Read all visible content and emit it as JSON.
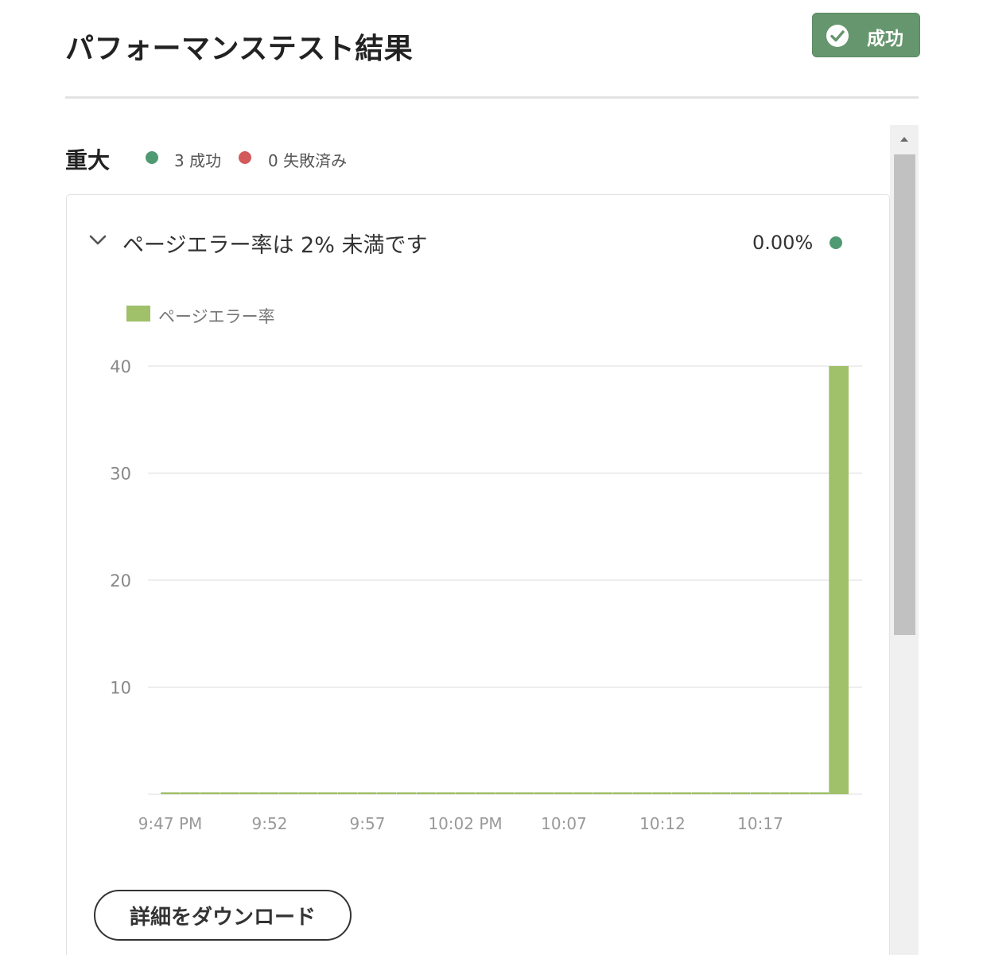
{
  "header": {
    "title": "パフォーマンステスト結果",
    "status_badge": {
      "label": "成功",
      "icon": "check-circle-icon",
      "color": "#66966d"
    }
  },
  "section": {
    "title": "重大",
    "success_count": "3",
    "success_label": "成功",
    "failed_count": "0",
    "failed_label": "失敗済み",
    "success_color": "#4f9a72",
    "failed_color": "#d35a5a"
  },
  "card": {
    "title": "ページエラー率は 2% 未満です",
    "value": "0.00%",
    "status_color": "#4f9a72",
    "expand_icon": "chevron-down-icon"
  },
  "chart_data": {
    "type": "bar",
    "legend": "ページエラー率",
    "color": "#a0c06a",
    "ylim": [
      0,
      40
    ],
    "yticks": [
      10,
      20,
      30,
      40
    ],
    "xticks": [
      "9:47 PM",
      "9:52",
      "9:57",
      "10:02 PM",
      "10:07",
      "10:12",
      "10:17"
    ],
    "bars": [
      {
        "x": "9:47 PM",
        "y": 0
      },
      {
        "x": "9:48",
        "y": 0
      },
      {
        "x": "9:49",
        "y": 0
      },
      {
        "x": "9:50",
        "y": 0
      },
      {
        "x": "9:51",
        "y": 0
      },
      {
        "x": "9:52",
        "y": 0
      },
      {
        "x": "9:53",
        "y": 0
      },
      {
        "x": "9:54",
        "y": 0
      },
      {
        "x": "9:55",
        "y": 0
      },
      {
        "x": "9:56",
        "y": 0
      },
      {
        "x": "9:57",
        "y": 0
      },
      {
        "x": "9:58",
        "y": 0
      },
      {
        "x": "9:59",
        "y": 0
      },
      {
        "x": "10:00",
        "y": 0
      },
      {
        "x": "10:01",
        "y": 0
      },
      {
        "x": "10:02 PM",
        "y": 0
      },
      {
        "x": "10:03",
        "y": 0
      },
      {
        "x": "10:04",
        "y": 0
      },
      {
        "x": "10:05",
        "y": 0
      },
      {
        "x": "10:06",
        "y": 0
      },
      {
        "x": "10:07",
        "y": 0
      },
      {
        "x": "10:08",
        "y": 0
      },
      {
        "x": "10:09",
        "y": 0
      },
      {
        "x": "10:10",
        "y": 0
      },
      {
        "x": "10:11",
        "y": 0
      },
      {
        "x": "10:12",
        "y": 0
      },
      {
        "x": "10:13",
        "y": 0
      },
      {
        "x": "10:14",
        "y": 0
      },
      {
        "x": "10:15",
        "y": 0
      },
      {
        "x": "10:16",
        "y": 0
      },
      {
        "x": "10:17",
        "y": 0
      },
      {
        "x": "10:18",
        "y": 0
      },
      {
        "x": "10:19",
        "y": 0
      },
      {
        "x": "10:20",
        "y": 0
      },
      {
        "x": "10:21",
        "y": 40
      }
    ],
    "grid": true
  },
  "actions": {
    "download_label": "詳細をダウンロード"
  }
}
